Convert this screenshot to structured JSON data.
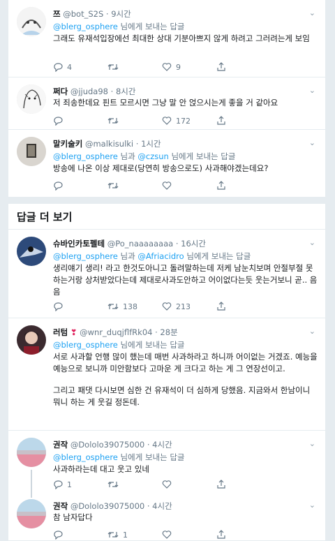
{
  "tweets": [
    {
      "name": "쯔",
      "handle": "@bot_S2S",
      "time": "· 9시간",
      "reply_prefix": "",
      "reply_users": "@blerg_osphere",
      "reply_suffix": "님에게 보내는 답글",
      "body": "그래도 유재석입장에선 최대한 상대 기분아쁘지 않게 하려고 그러려는게 보임",
      "replies": "4",
      "retweets": "",
      "likes": "9"
    },
    {
      "name": "쩌다",
      "handle": "@jjuda98",
      "time": "· 8시간",
      "body": "저 죄송한데요 핀트 모르시면 그냥 말 안 얹으시는게 좋을 거 같아요",
      "replies": "",
      "retweets": "",
      "likes": "172"
    },
    {
      "name": "말키술키",
      "handle": "@malkisulki",
      "time": "· 1시간",
      "reply_users": "@blerg_osphere",
      "reply_mid": "님과",
      "reply_users2": "@czsun",
      "reply_suffix": "님에게 보내는 답글",
      "body": "방송에 나온 이상 제대로(당연히 방송으로도) 사과해야겠는데요?",
      "replies": "",
      "retweets": "",
      "likes": ""
    },
    {
      "name": "슈바인카토펠테",
      "handle": "@Po_naaaaaaaa",
      "time": "· 16시간",
      "reply_users": "@blerg_osphere",
      "reply_mid": "님과",
      "reply_users2": "@Afriacidro",
      "reply_suffix": "님에게 보내는 답글",
      "body": "생리얘기 생리! 라고 한것도아니고 돌려말하는데 저케 남눈치보며 안절부절 못하는거랑 상처받았다는데 제대로사과도안하고 어이없다는듯 웃는거보니 곧.. 음음",
      "replies": "",
      "retweets": "138",
      "likes": "213"
    },
    {
      "name": "러텀",
      "handle": "@wnr_duqjflfRk04",
      "time": "· 28분",
      "reply_users": "@blerg_osphere",
      "reply_suffix": "님에게 보내는 답글",
      "body": "서로 사과할 언행 많이 했는데 매번 사과하라고 하니까 어이없는 거겠죠. 예능을 예능으로 보니까 미안함보다 고마운 게 크다고 하는 게 그 연장선이고.",
      "body2": "그리고 패댓 다시보면 심한 건 유재석이 더 심하게 당했음. 지금와서 한남이니 뭐니 하는 게 웃길 정돈데.",
      "replies": "",
      "retweets": "",
      "likes": ""
    },
    {
      "name": "권작",
      "handle": "@Dololo39075000",
      "time": "· 4시간",
      "reply_users": "@blerg_osphere",
      "reply_suffix": "님에게 보내는 답글",
      "body": "사과하라는데 대고 웃고 있네",
      "replies": "1",
      "retweets": "",
      "likes": ""
    },
    {
      "name": "권작",
      "handle": "@Dololo39075000",
      "time": "· 4시간",
      "body": "참 남자답다",
      "replies": "",
      "retweets": "1",
      "likes": ""
    }
  ],
  "more_replies_label": "답글 더 보기",
  "colors": {
    "accent": "#1da1f2",
    "muted": "#657786",
    "divider": "#e6ecf0"
  },
  "icons": [
    "reply-icon",
    "retweet-icon",
    "like-icon",
    "share-icon",
    "chevron-down-icon"
  ]
}
